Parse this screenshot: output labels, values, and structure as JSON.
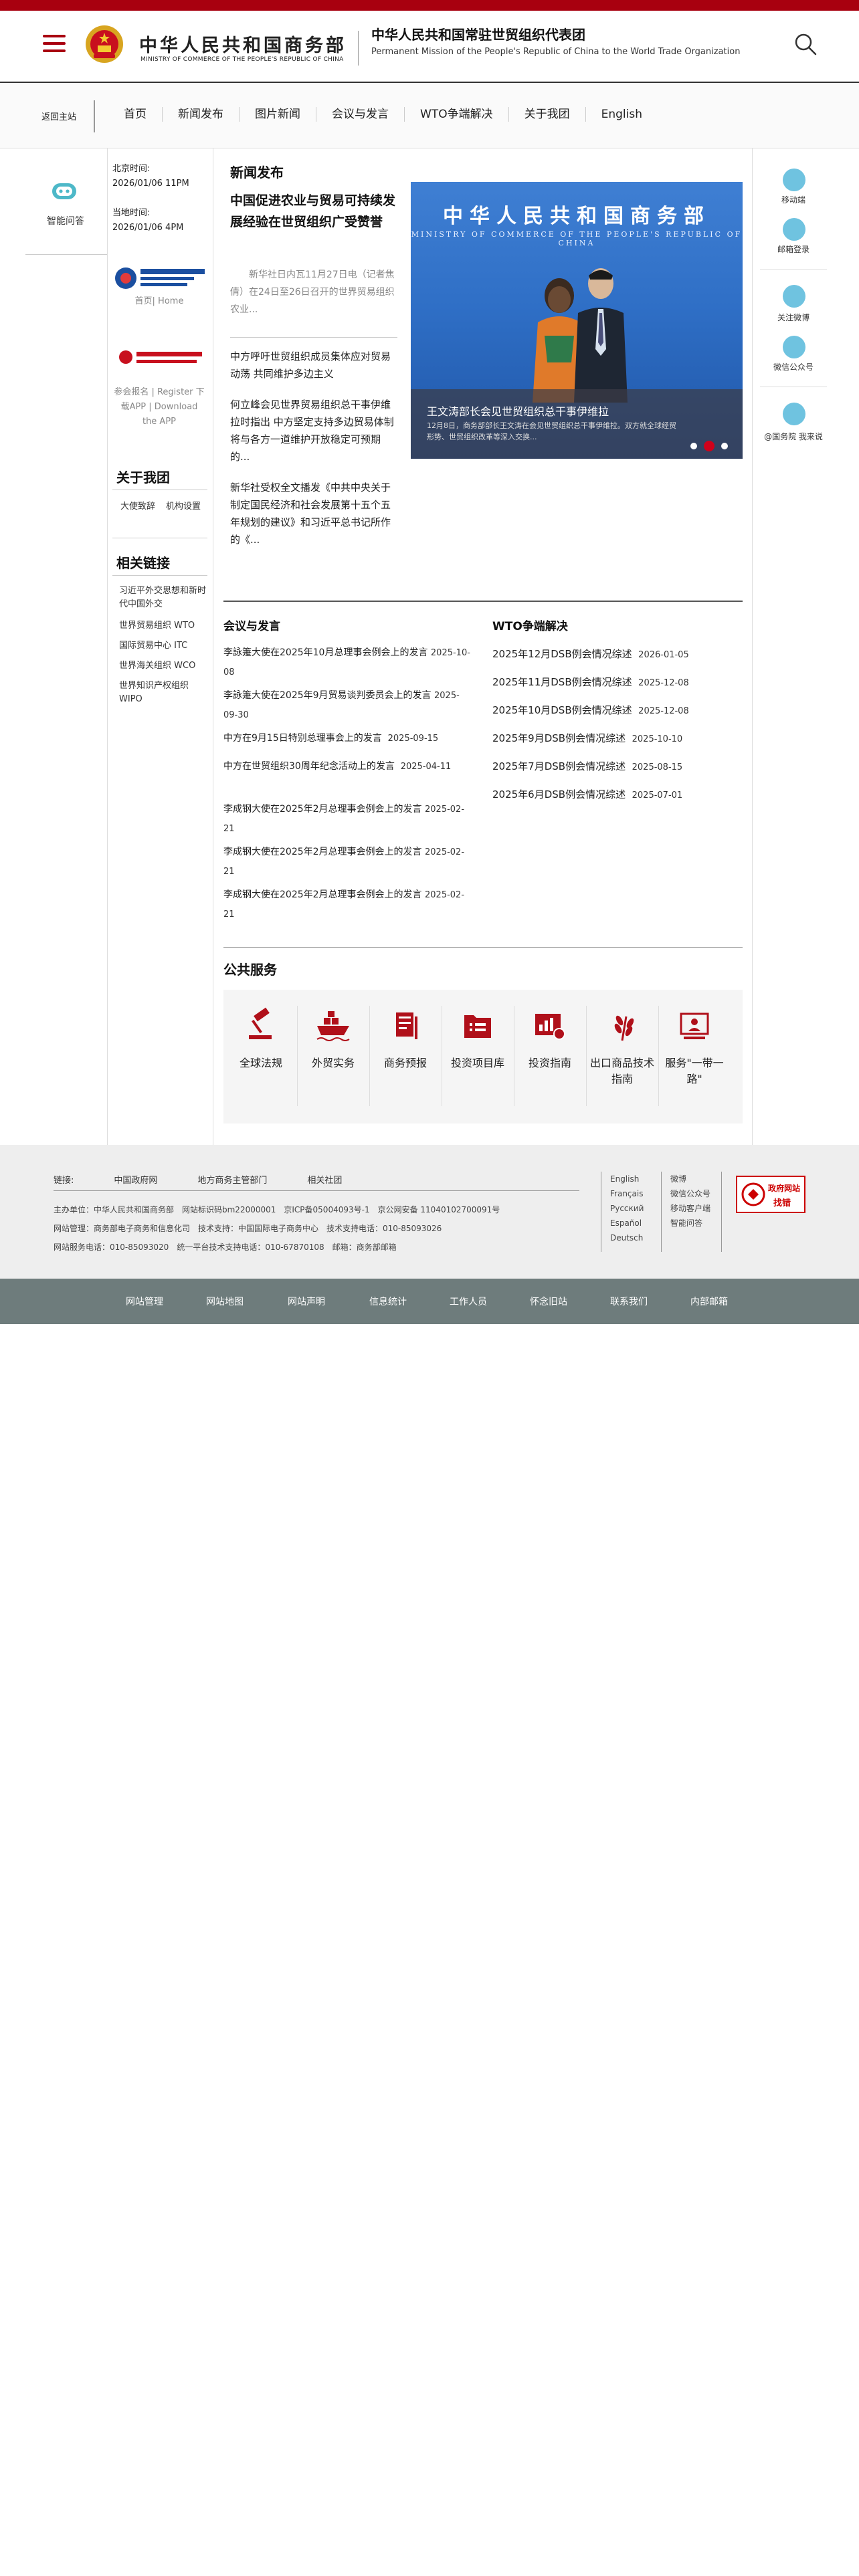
{
  "header": {
    "brand_cn": "中华人民共和国商务部",
    "brand_en": "MINISTRY OF COMMERCE OF THE PEOPLE'S REPUBLIC OF CHINA",
    "mission_cn": "中华人民共和国常驻世贸组织代表团",
    "mission_en": "Permanent Mission of the People's Republic of China to the World Trade Organization"
  },
  "nav": {
    "home": "返回主站",
    "items": [
      "首页",
      "新闻发布",
      "图片新闻",
      "会议与发言",
      "WTO争端解决",
      "关于我团",
      "English"
    ]
  },
  "left": {
    "smart_qa": "智能问答"
  },
  "side": {
    "beijing_label": "北京时间:",
    "beijing_time": "2026/01/06 11PM",
    "local_label": "当地时间:",
    "local_time": "2026/01/06 4PM",
    "expo1": "首页| Home",
    "expo2": "参会报名 | Register 下载APP | Download the APP",
    "about_title": "关于我团",
    "about_links": [
      "大使致辞",
      "机构设置"
    ],
    "related_title": "相关链接",
    "related_links": [
      "习近平外交思想和新时代中国外交",
      "世界贸易组织 WTO",
      "国际贸易中心 ITC",
      "世界海关组织 WCO",
      "世界知识产权组织 WIPO"
    ]
  },
  "news": {
    "heading": "新闻发布",
    "lead_title": "中国促进农业与贸易可持续发展经验在世贸组织广受赞誉",
    "lead_body": "新华社日内瓦11月27日电（记者焦倩）在24日至26日召开的世界贸易组织农业...",
    "items": [
      "中方呼吁世贸组织成员集体应对贸易动荡 共同维护多边主义",
      "何立峰会见世界贸易组织总干事伊维拉时指出 中方坚定支持多边贸易体制 将与各方一道维护开放稳定可预期的...",
      "新华社受权全文播发《中共中央关于制定国民经济和社会发展第十五个五年规划的建议》和习近平总书记所作的《..."
    ]
  },
  "carousel": {
    "banner_cn": "中华人民共和国商务部",
    "banner_en": "MINISTRY OF COMMERCE OF THE PEOPLE'S REPUBLIC OF CHINA",
    "caption_title": "王文涛部长会见世贸组织总干事伊维拉",
    "caption_body": "12月8日，商务部部长王文涛在会见世贸组织总干事伊维拉。双方就全球经贸形势、世贸组织改革等深入交换..."
  },
  "meetings": {
    "title": "会议与发言",
    "items": [
      {
        "text": "李詠箑大使在2025年10月总理事会例会上的发言",
        "date": "2025-10-08"
      },
      {
        "text": "李詠箑大使在2025年9月贸易谈判委员会上的发言",
        "date": "2025-09-30"
      },
      {
        "text": "中方在9月15日特别总理事会上的发言",
        "date": "2025-09-15"
      },
      {
        "text": "中方在世贸组织30周年纪念活动上的发言",
        "date": "2025-04-11"
      },
      {
        "text": "李成钢大使在2025年2月总理事会例会上的发言",
        "date": "2025-02-21"
      },
      {
        "text": "李成钢大使在2025年2月总理事会例会上的发言",
        "date": "2025-02-21"
      },
      {
        "text": "李成钢大使在2025年2月总理事会例会上的发言",
        "date": "2025-02-21"
      }
    ]
  },
  "wto": {
    "title": "WTO争端解决",
    "items": [
      {
        "text": "2025年12月DSB例会情况综述",
        "date": "2026-01-05"
      },
      {
        "text": "2025年11月DSB例会情况综述",
        "date": "2025-12-08"
      },
      {
        "text": "2025年10月DSB例会情况综述",
        "date": "2025-12-08"
      },
      {
        "text": "2025年9月DSB例会情况综述",
        "date": "2025-10-10"
      },
      {
        "text": "2025年7月DSB例会情况综述",
        "date": "2025-08-15"
      },
      {
        "text": "2025年6月DSB例会情况综述",
        "date": "2025-07-01"
      }
    ]
  },
  "services": {
    "title": "公共服务",
    "items": [
      "全球法规",
      "外贸实务",
      "商务预报",
      "投资项目库",
      "投资指南",
      "出口商品技术指南",
      "服务\"一带一路\""
    ]
  },
  "right": {
    "items": [
      "移动端",
      "邮箱登录",
      "关注微博",
      "微信公众号",
      "@国务院 我来说"
    ]
  },
  "footer": {
    "links_label": "链接:",
    "links": [
      "中国政府网",
      "地方商务主管部门",
      "相关社团"
    ],
    "line1": "主办单位：中华人民共和国商务部　网站标识码bm22000001　京ICP备05004093号-1　京公网安备 11040102700091号",
    "line2": "网站管理：商务部电子商务和信息化司　技术支持：中国国际电子商务中心　技术支持电话：010-85093026",
    "line3": "网站服务电话：010-85093020　统一平台技术支持电话：010-67870108　邮箱：商务部邮箱",
    "langs": [
      "English",
      "Français",
      "Русский",
      "Español",
      "Deutsch"
    ],
    "social": [
      "微博",
      "微信公众号",
      "移动客户端",
      "智能问答"
    ],
    "gov_badge_top": "政府网站",
    "gov_badge_bottom": "找错"
  },
  "bottom_nav": [
    "网站管理",
    "网站地图",
    "网站声明",
    "信息统计",
    "工作人员",
    "怀念旧站",
    "联系我们",
    "内部邮箱"
  ],
  "colors": {
    "brand_red": "#a8000f",
    "icon_teal": "#6fc3e0",
    "service_red": "#b0101a",
    "bottom_nav_bg": "#6e7c7c"
  }
}
